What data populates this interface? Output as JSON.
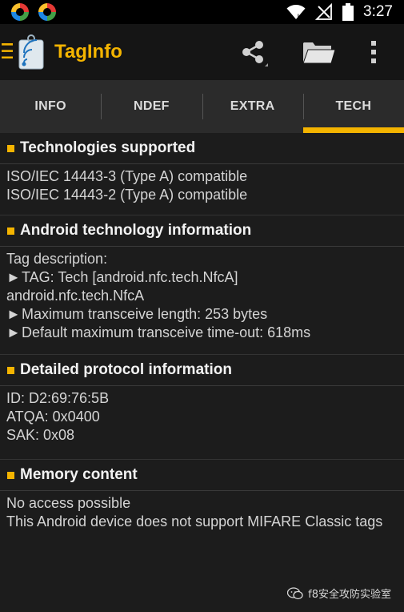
{
  "status_bar": {
    "time": "3:27",
    "icons": [
      "app-notification-icon",
      "app-notification-icon",
      "wifi-icon",
      "no-signal-icon",
      "battery-icon"
    ]
  },
  "action_bar": {
    "title": "TagInfo",
    "up_icon": "menu-icon",
    "logo_icon": "nfc-tag-icon",
    "actions": [
      "share-icon",
      "folder-icon",
      "overflow-menu-icon"
    ]
  },
  "tabs": [
    {
      "label": "INFO",
      "active": false
    },
    {
      "label": "NDEF",
      "active": false
    },
    {
      "label": "EXTRA",
      "active": false
    },
    {
      "label": "TECH",
      "active": true
    }
  ],
  "sections": {
    "technologies": {
      "title": "Technologies supported",
      "lines": [
        "ISO/IEC 14443-3 (Type A) compatible",
        "ISO/IEC 14443-2 (Type A) compatible"
      ]
    },
    "android": {
      "title": "Android technology information",
      "line0": "Tag description:",
      "line1": "TAG: Tech [android.nfc.tech.NfcA]",
      "line2": "android.nfc.tech.NfcA",
      "line3": "Maximum transceive length: 253 bytes",
      "line4": "Default maximum transceive time-out: 618ms",
      "arrow": "►"
    },
    "protocol": {
      "title": "Detailed protocol information",
      "lines": [
        "ID: D2:69:76:5B",
        "ATQA: 0x0400",
        "SAK: 0x08"
      ]
    },
    "memory": {
      "title": "Memory content",
      "lines": [
        "No access possible",
        "This Android device does not support MIFARE Classic tags"
      ]
    }
  },
  "watermark": {
    "text": "f8安全攻防实验室",
    "icon": "wechat-icon"
  },
  "colors": {
    "accent": "#f4b400",
    "background": "#1c1c1c",
    "tab_bar": "#2b2b2b"
  }
}
